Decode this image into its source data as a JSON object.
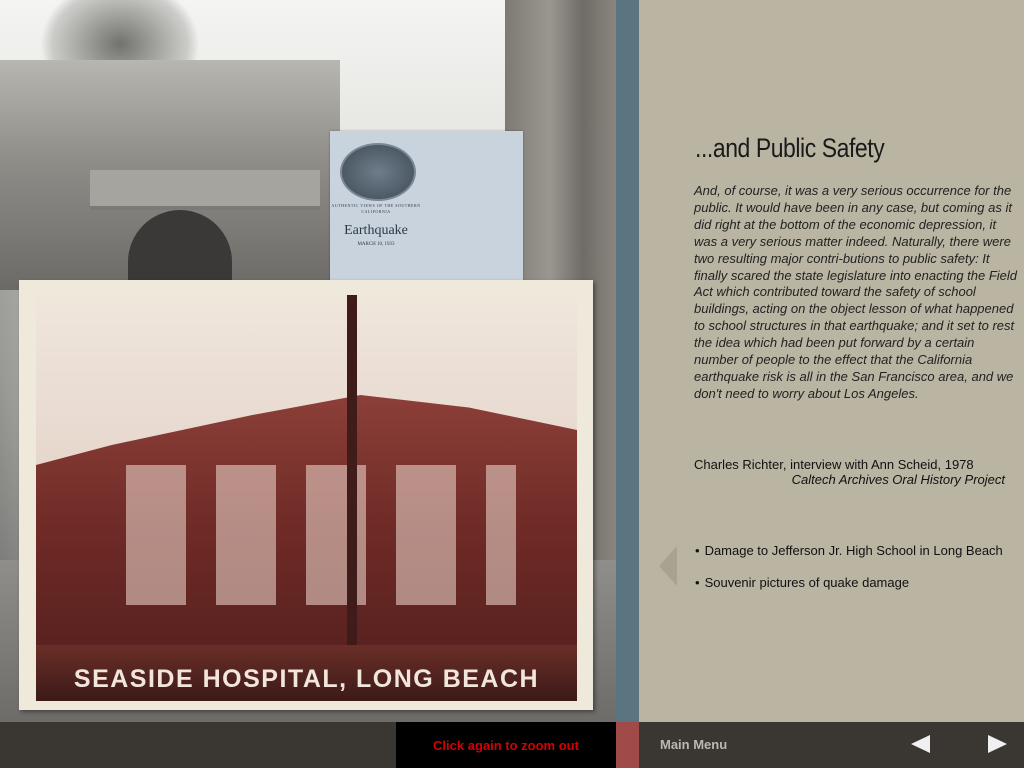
{
  "panel": {
    "title": "...and Public Safety",
    "body": "And, of course, it was a very serious occurrence for the public. It would have been in any case, but coming as it did right at the bottom of the economic depression, it was a very serious matter indeed. Naturally, there were two resulting major contri-butions to public safety: It finally scared the state legislature into enacting the Field Act which contributed toward the safety of school buildings, acting on the object lesson of what happened to school structures in that earthquake; and it set to rest the idea which had been put forward by a certain number of people to the effect that the California earthquake risk is all in the San Francisco area, and we don't need to worry about Los Angeles.",
    "citation_name": "Charles Richter, interview with Ann Scheid, 1978",
    "citation_source": "Caltech Archives Oral History Project",
    "bullets": [
      {
        "label": "Damage to Jefferson Jr. High School in Long Beach"
      },
      {
        "label": "Souvenir pictures of quake damage"
      }
    ],
    "bullet_symbol": "•"
  },
  "photos": {
    "hospital_caption": "SEASIDE HOSPITAL, LONG BEACH",
    "souvenir": {
      "line1": "AUTHENTIC VIEWS OF THE SOUTHERN CALIFORNIA",
      "title": "Earthquake",
      "date": "MARCH 10, 1933"
    }
  },
  "bottom_bar": {
    "zoom_label": "Click again to zoom out",
    "main_menu_label": "Main Menu"
  },
  "icons": {
    "back": "triangle-left-icon",
    "prev": "arrow-left-icon",
    "next": "arrow-right-icon"
  },
  "colors": {
    "panel_bg": "#bab4a2",
    "divider": "#5a7480",
    "bottom_bar": "#3a3733",
    "zoom_text": "#d40000",
    "red_spacer": "#a14a4a"
  }
}
